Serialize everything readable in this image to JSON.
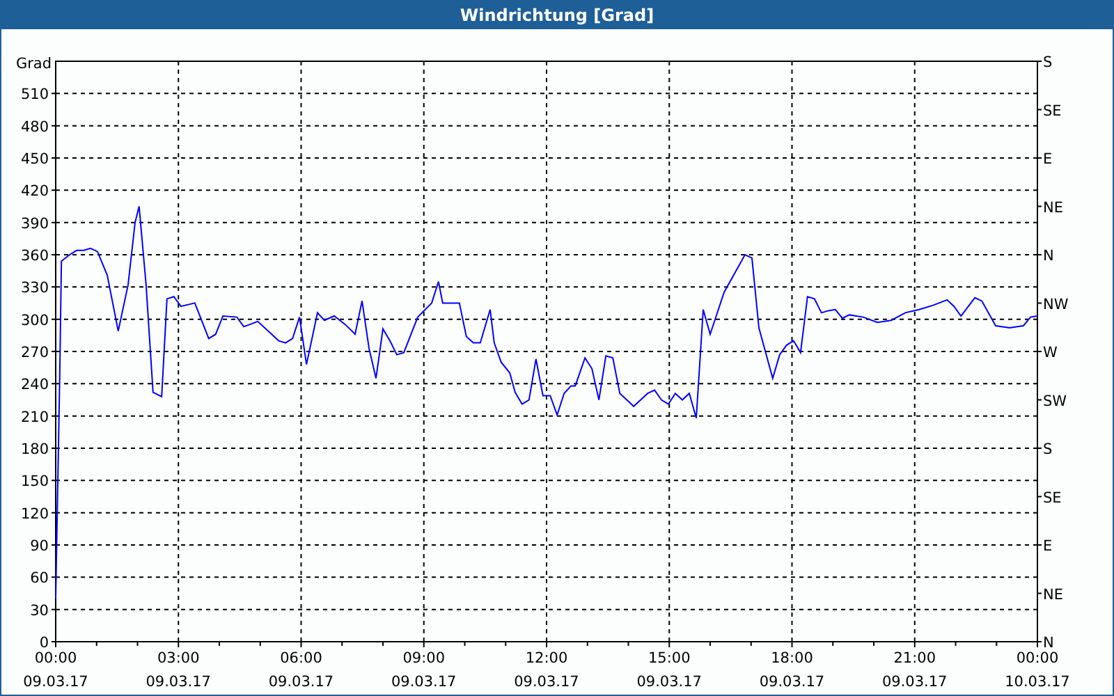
{
  "window": {
    "title": "Windrichtung [Grad]"
  },
  "chart_data": {
    "type": "line",
    "ylabel": "Grad",
    "x": [
      0,
      0.03,
      0.1,
      0.14,
      0.34,
      0.51,
      0.68,
      0.85,
      1.02,
      1.26,
      1.53,
      1.77,
      1.94,
      2.04,
      2.21,
      2.38,
      2.59,
      2.72,
      2.89,
      3.06,
      3.4,
      3.74,
      3.91,
      4.09,
      4.43,
      4.6,
      4.94,
      5.28,
      5.45,
      5.62,
      5.79,
      5.96,
      6.13,
      6.4,
      6.57,
      6.81,
      7.08,
      7.32,
      7.49,
      7.66,
      7.83,
      8.0,
      8.17,
      8.34,
      8.51,
      8.85,
      9.19,
      9.36,
      9.46,
      9.87,
      10.04,
      10.21,
      10.38,
      10.62,
      10.72,
      10.89,
      11.1,
      11.23,
      11.4,
      11.57,
      11.74,
      11.91,
      12.09,
      12.26,
      12.43,
      12.6,
      12.7,
      12.94,
      13.11,
      13.28,
      13.45,
      13.62,
      13.79,
      13.96,
      14.13,
      14.3,
      14.47,
      14.64,
      14.81,
      14.98,
      15.15,
      15.32,
      15.49,
      15.66,
      15.83,
      16.0,
      16.34,
      16.85,
      17.02,
      17.19,
      17.53,
      17.7,
      17.87,
      18.04,
      18.21,
      18.38,
      18.55,
      18.72,
      18.89,
      19.06,
      19.23,
      19.4,
      19.74,
      20.09,
      20.43,
      20.77,
      21.11,
      21.45,
      21.79,
      21.96,
      22.13,
      22.47,
      22.64,
      22.98,
      23.32,
      23.66,
      23.83,
      24.0
    ],
    "series": [
      {
        "color": "#0000ff",
        "values": [
          40,
          105,
          247,
          354,
          360,
          364,
          364,
          366,
          363,
          341,
          289,
          332,
          390,
          405,
          332,
          232,
          228,
          319,
          321,
          312,
          315,
          282,
          286,
          303,
          302,
          293,
          298,
          286,
          280,
          278,
          282,
          302,
          258,
          306,
          299,
          303,
          295,
          286,
          317,
          273,
          245,
          291,
          280,
          267,
          269,
          302,
          315,
          335,
          315,
          315,
          284,
          278,
          278,
          309,
          278,
          260,
          250,
          232,
          221,
          225,
          263,
          229,
          229,
          211,
          231,
          238,
          238,
          264,
          254,
          225,
          266,
          264,
          231,
          225,
          219,
          225,
          231,
          234,
          225,
          221,
          231,
          225,
          231,
          208,
          309,
          286,
          325,
          360,
          357,
          292,
          245,
          267,
          276,
          280,
          269,
          321,
          319,
          306,
          308,
          309,
          301,
          304,
          302,
          297,
          299,
          306,
          309,
          313,
          318,
          312,
          303,
          320,
          317,
          294,
          292,
          294,
          302,
          303
        ]
      }
    ],
    "xlim": [
      0,
      24
    ],
    "ylim": [
      0,
      540
    ],
    "xticks": [
      {
        "value": 0,
        "label": "00:00"
      },
      {
        "value": 3,
        "label": "03:00"
      },
      {
        "value": 6,
        "label": "06:00"
      },
      {
        "value": 9,
        "label": "09:00"
      },
      {
        "value": 12,
        "label": "12:00"
      },
      {
        "value": 15,
        "label": "15:00"
      },
      {
        "value": 18,
        "label": "18:00"
      },
      {
        "value": 21,
        "label": "21:00"
      },
      {
        "value": 24,
        "label": "00:00"
      }
    ],
    "yticks": [
      0,
      30,
      60,
      90,
      120,
      150,
      180,
      210,
      240,
      270,
      300,
      330,
      360,
      390,
      420,
      450,
      480,
      510
    ],
    "grid": true
  },
  "x_axis_dates": [
    "09.03.17",
    "09.03.17",
    "09.03.17",
    "09.03.17",
    "09.03.17",
    "09.03.17",
    "09.03.17",
    "09.03.17",
    "10.03.17"
  ],
  "right_axis_labels": [
    "S",
    "SE",
    "E",
    "NE",
    "N",
    "NW",
    "W",
    "SW",
    "S",
    "SE",
    "E",
    "NE",
    "N"
  ]
}
